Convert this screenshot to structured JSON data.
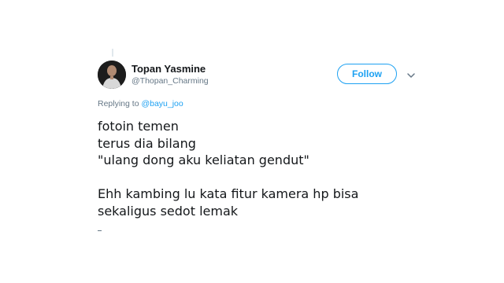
{
  "tweet": {
    "author": {
      "display_name": "Topan Yasmine",
      "handle": "@Thopan_Charming",
      "avatar_icon": "avatar-photo"
    },
    "follow_label": "Follow",
    "menu_icon": "chevron-down-icon",
    "replying_prefix": "Replying to",
    "replying_to": "@bayu_joo",
    "text_lines": [
      "fotoin temen",
      "terus dia bilang",
      "\"ulang dong aku keliatan gendut\"",
      "Ehh kambing lu kata fitur kamera hp bisa",
      "sekaligus sedot lemak"
    ]
  },
  "colors": {
    "accent": "#1da1f2",
    "text": "#14171a",
    "secondary": "#657786"
  }
}
